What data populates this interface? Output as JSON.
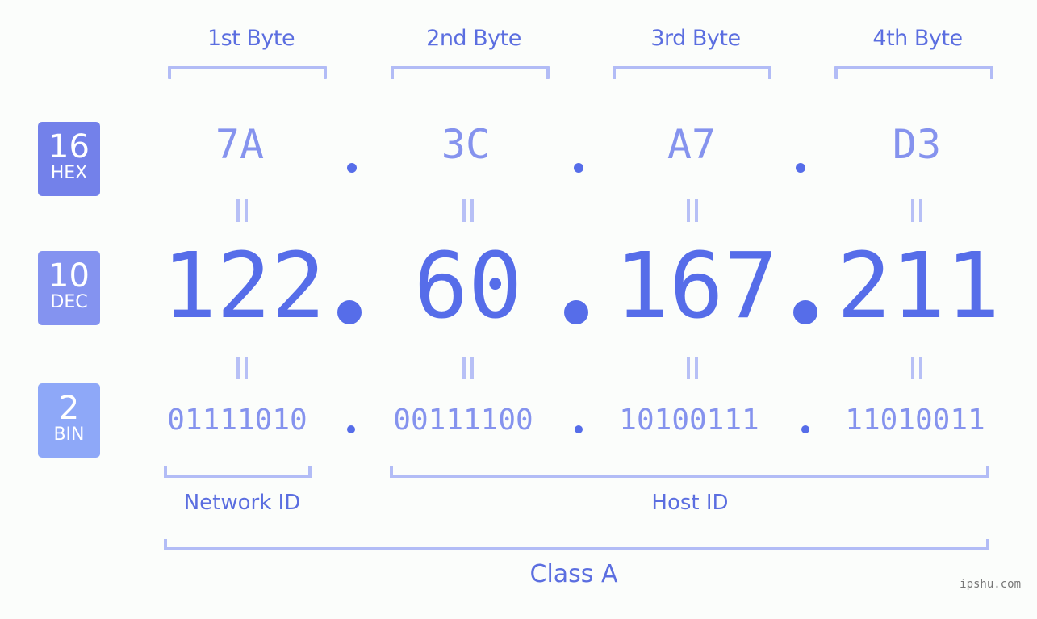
{
  "byte_labels": [
    "1st Byte",
    "2nd Byte",
    "3rd Byte",
    "4th Byte"
  ],
  "bases": [
    {
      "number": "16",
      "name": "HEX",
      "color": "#7381ea"
    },
    {
      "number": "10",
      "name": "DEC",
      "color": "#8493f0"
    },
    {
      "number": "2",
      "name": "BIN",
      "color": "#8ea8f8"
    }
  ],
  "hex": [
    "7A",
    "3C",
    "A7",
    "D3"
  ],
  "dec": [
    "122",
    "60",
    "167",
    "211"
  ],
  "bin": [
    "01111010",
    "00111100",
    "10100111",
    "11010011"
  ],
  "separator": ".",
  "network_id_label": "Network ID",
  "host_id_label": "Host ID",
  "class_label": "Class A",
  "watermark": "ipshu.com",
  "colors": {
    "accent": "#566de9",
    "light_accent": "#8593ee",
    "bracket": "#b2bcf6",
    "background": "#fbfdfb"
  }
}
